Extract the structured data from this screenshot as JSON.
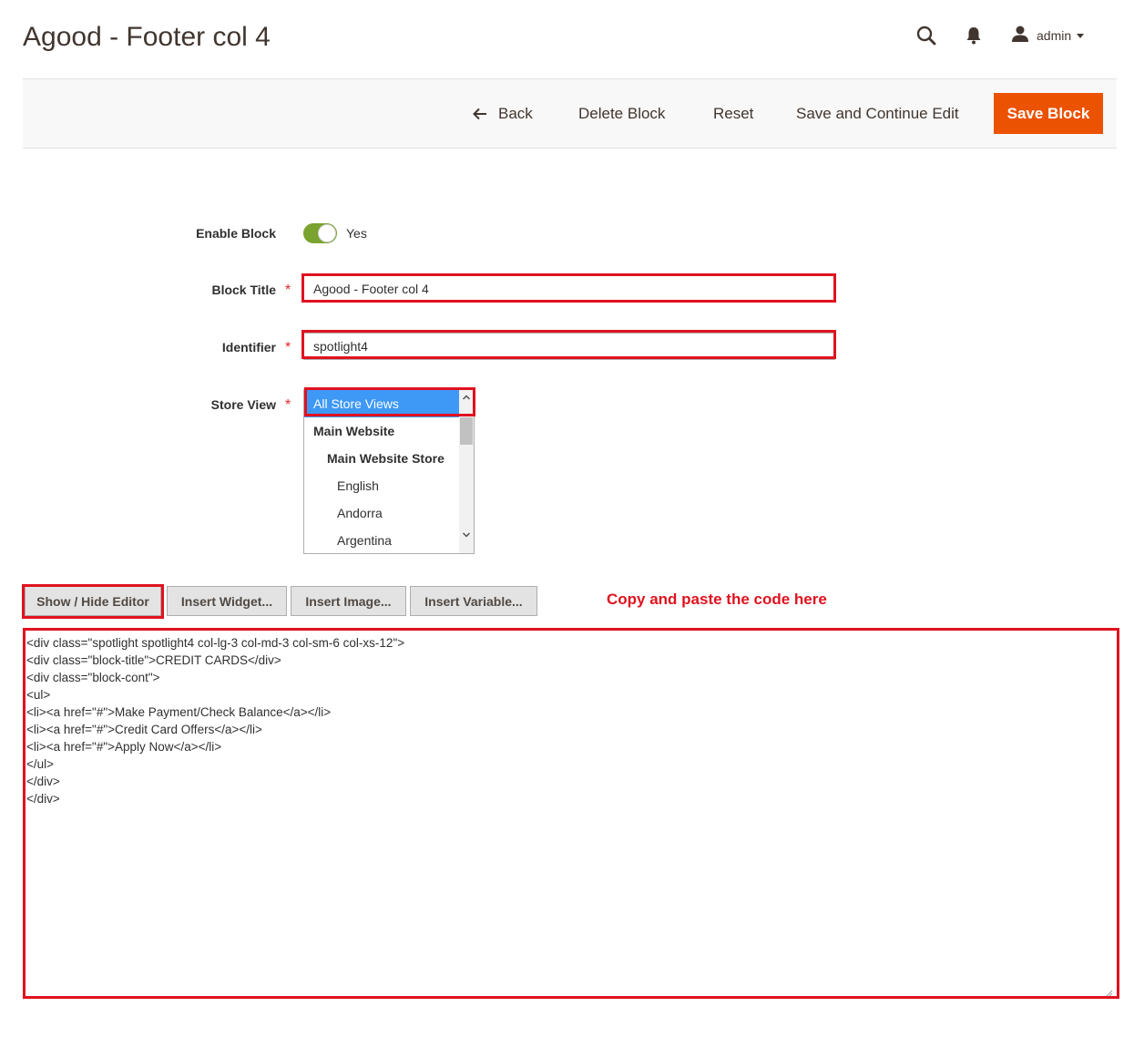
{
  "page": {
    "title": "Agood - Footer col 4"
  },
  "header": {
    "user_name": "admin"
  },
  "actions": {
    "back": "Back",
    "delete": "Delete Block",
    "reset": "Reset",
    "save_continue": "Save and Continue Edit",
    "save": "Save Block"
  },
  "form": {
    "enable_label": "Enable Block",
    "enable_value": "Yes",
    "title_label": "Block Title",
    "title_value": "Agood - Footer col 4",
    "identifier_label": "Identifier",
    "identifier_value": "spotlight4",
    "store_label": "Store View",
    "store_options": [
      "All Store Views",
      "Main Website",
      "Main Website Store",
      "English",
      "Andorra",
      "Argentina"
    ],
    "required_mark": "*"
  },
  "editor": {
    "show_hide": "Show / Hide Editor",
    "insert_widget": "Insert Widget...",
    "insert_image": "Insert Image...",
    "insert_variable": "Insert Variable...",
    "annotation": "Copy and paste the code here",
    "code_lines": [
      "<div class=\"spotlight spotlight4 col-lg-3 col-md-3 col-sm-6 col-xs-12\">",
      "<div class=\"block-title\">CREDIT CARDS</div>",
      "<div class=\"block-cont\">",
      "<ul>",
      "<li><a href=\"#\">Make Payment/Check Balance</a></li>",
      "<li><a href=\"#\">Credit Card Offers</a></li>",
      "<li><a href=\"#\">Apply Now</a></li>",
      "</ul>",
      "</div>",
      "</div>"
    ]
  },
  "colors": {
    "accent": "#eb5202",
    "toggle_on": "#79a22e",
    "selected": "#3d98f6",
    "highlight": "#e0121f"
  }
}
